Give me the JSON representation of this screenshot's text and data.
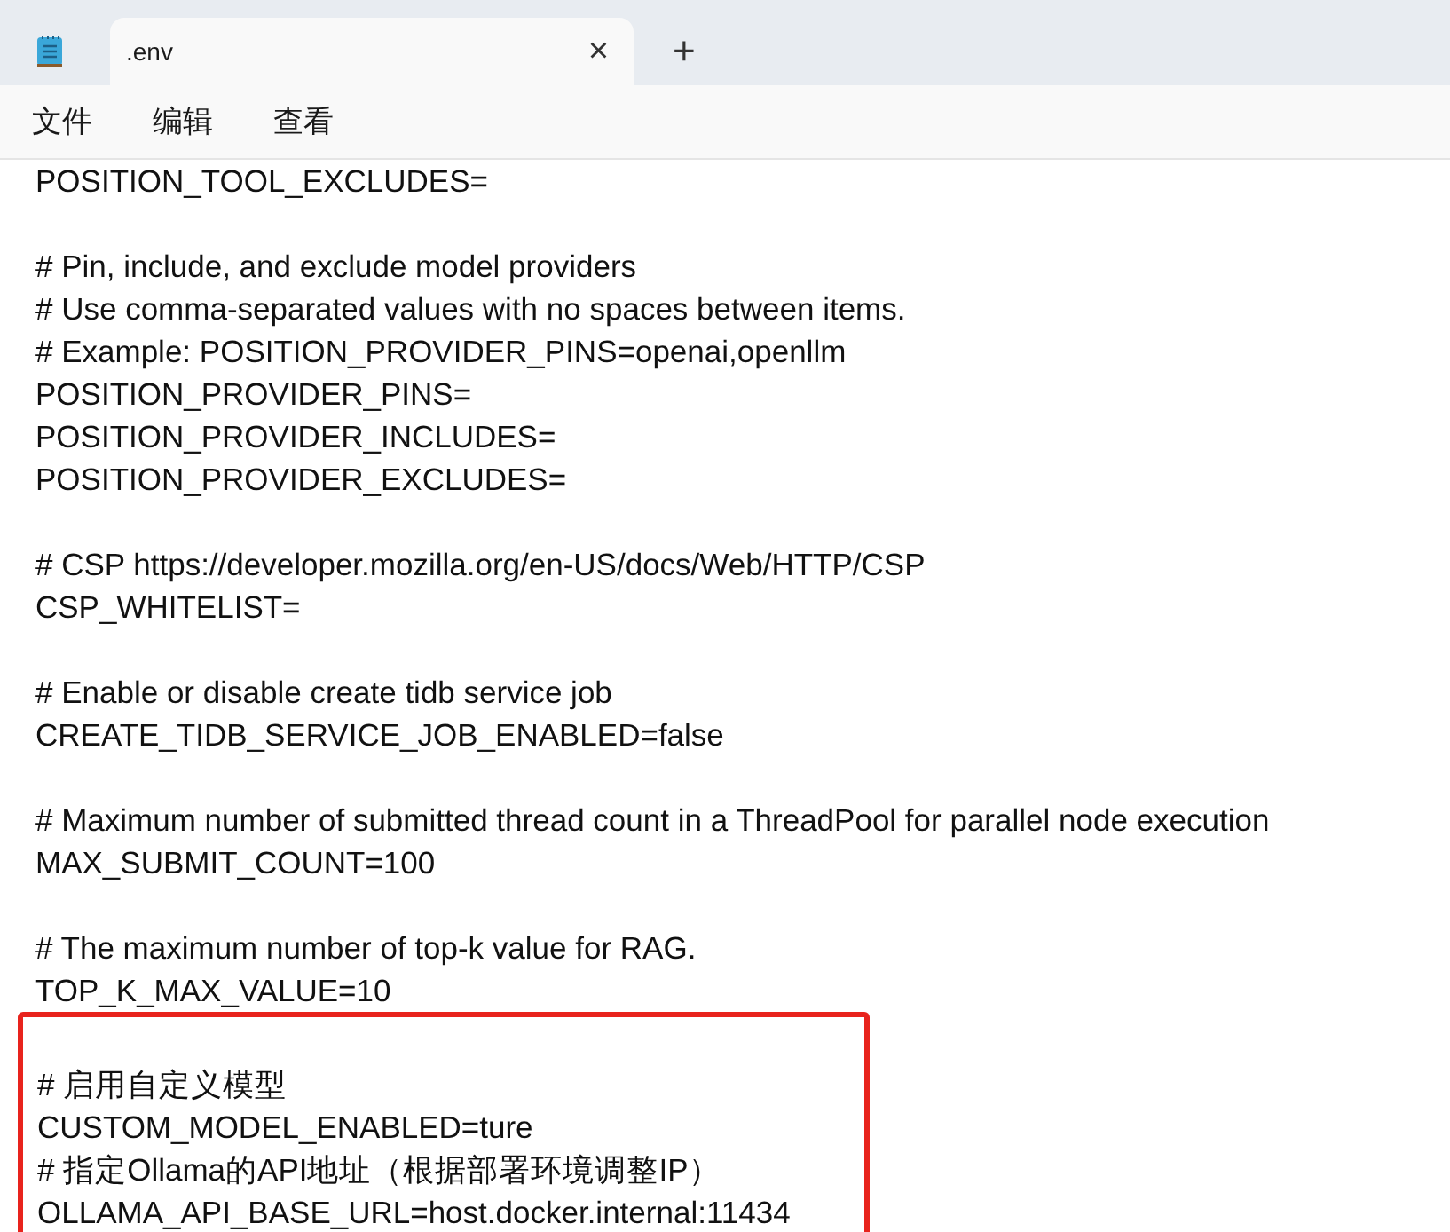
{
  "tab": {
    "title": ".env",
    "close": "×",
    "selected": true
  },
  "new_tab": "+",
  "menu": [
    "文件",
    "编辑",
    "查看"
  ],
  "blocks": [
    {
      "highlighted": false,
      "lines": [
        "POSITION_TOOL_EXCLUDES="
      ]
    },
    {
      "highlighted": false,
      "lines": [
        "# Pin, include, and exclude model providers",
        "# Use comma-separated values with no spaces between items.",
        "# Example: POSITION_PROVIDER_PINS=openai,openllm",
        "POSITION_PROVIDER_PINS=",
        "POSITION_PROVIDER_INCLUDES=",
        "POSITION_PROVIDER_EXCLUDES="
      ]
    },
    {
      "highlighted": false,
      "lines": [
        "# CSP https://developer.mozilla.org/en-US/docs/Web/HTTP/CSP",
        "CSP_WHITELIST="
      ]
    },
    {
      "highlighted": false,
      "lines": [
        "# Enable or disable create tidb service job",
        "CREATE_TIDB_SERVICE_JOB_ENABLED=false"
      ]
    },
    {
      "highlighted": false,
      "lines": [
        "# Maximum number of submitted thread count in a ThreadPool for parallel node execution",
        "MAX_SUBMIT_COUNT=100"
      ]
    },
    {
      "highlighted": false,
      "lines": [
        "# The maximum number of top-k value for RAG.",
        "TOP_K_MAX_VALUE=10"
      ]
    },
    {
      "highlighted": true,
      "lines": [
        "# 启用自定义模型",
        "CUSTOM_MODEL_ENABLED=ture",
        "# 指定Ollama的API地址（根据部署环境调整IP）",
        "OLLAMA_API_BASE_URL=host.docker.internal:11434"
      ]
    }
  ]
}
